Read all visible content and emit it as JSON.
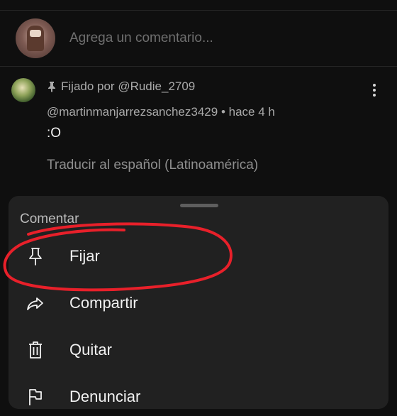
{
  "compose": {
    "placeholder": "Agrega un comentario..."
  },
  "comment": {
    "pinned_label": "Fijado por @Rudie_2709",
    "author": "@martinmanjarrezsanchez3429",
    "separator": "•",
    "time": "hace 4 h",
    "text": ":O",
    "translate": "Traducir al español (Latinoamérica)"
  },
  "sheet": {
    "title": "Comentar",
    "items": [
      {
        "label": "Fijar",
        "icon": "pin-icon"
      },
      {
        "label": "Compartir",
        "icon": "share-icon"
      },
      {
        "label": "Quitar",
        "icon": "trash-icon"
      },
      {
        "label": "Denunciar",
        "icon": "flag-icon"
      }
    ]
  },
  "colors": {
    "background": "#0f0f0f",
    "sheet": "#212121",
    "annotation": "#e8202a",
    "text_primary": "#f1f1f1",
    "text_secondary": "#aaaaaa"
  }
}
